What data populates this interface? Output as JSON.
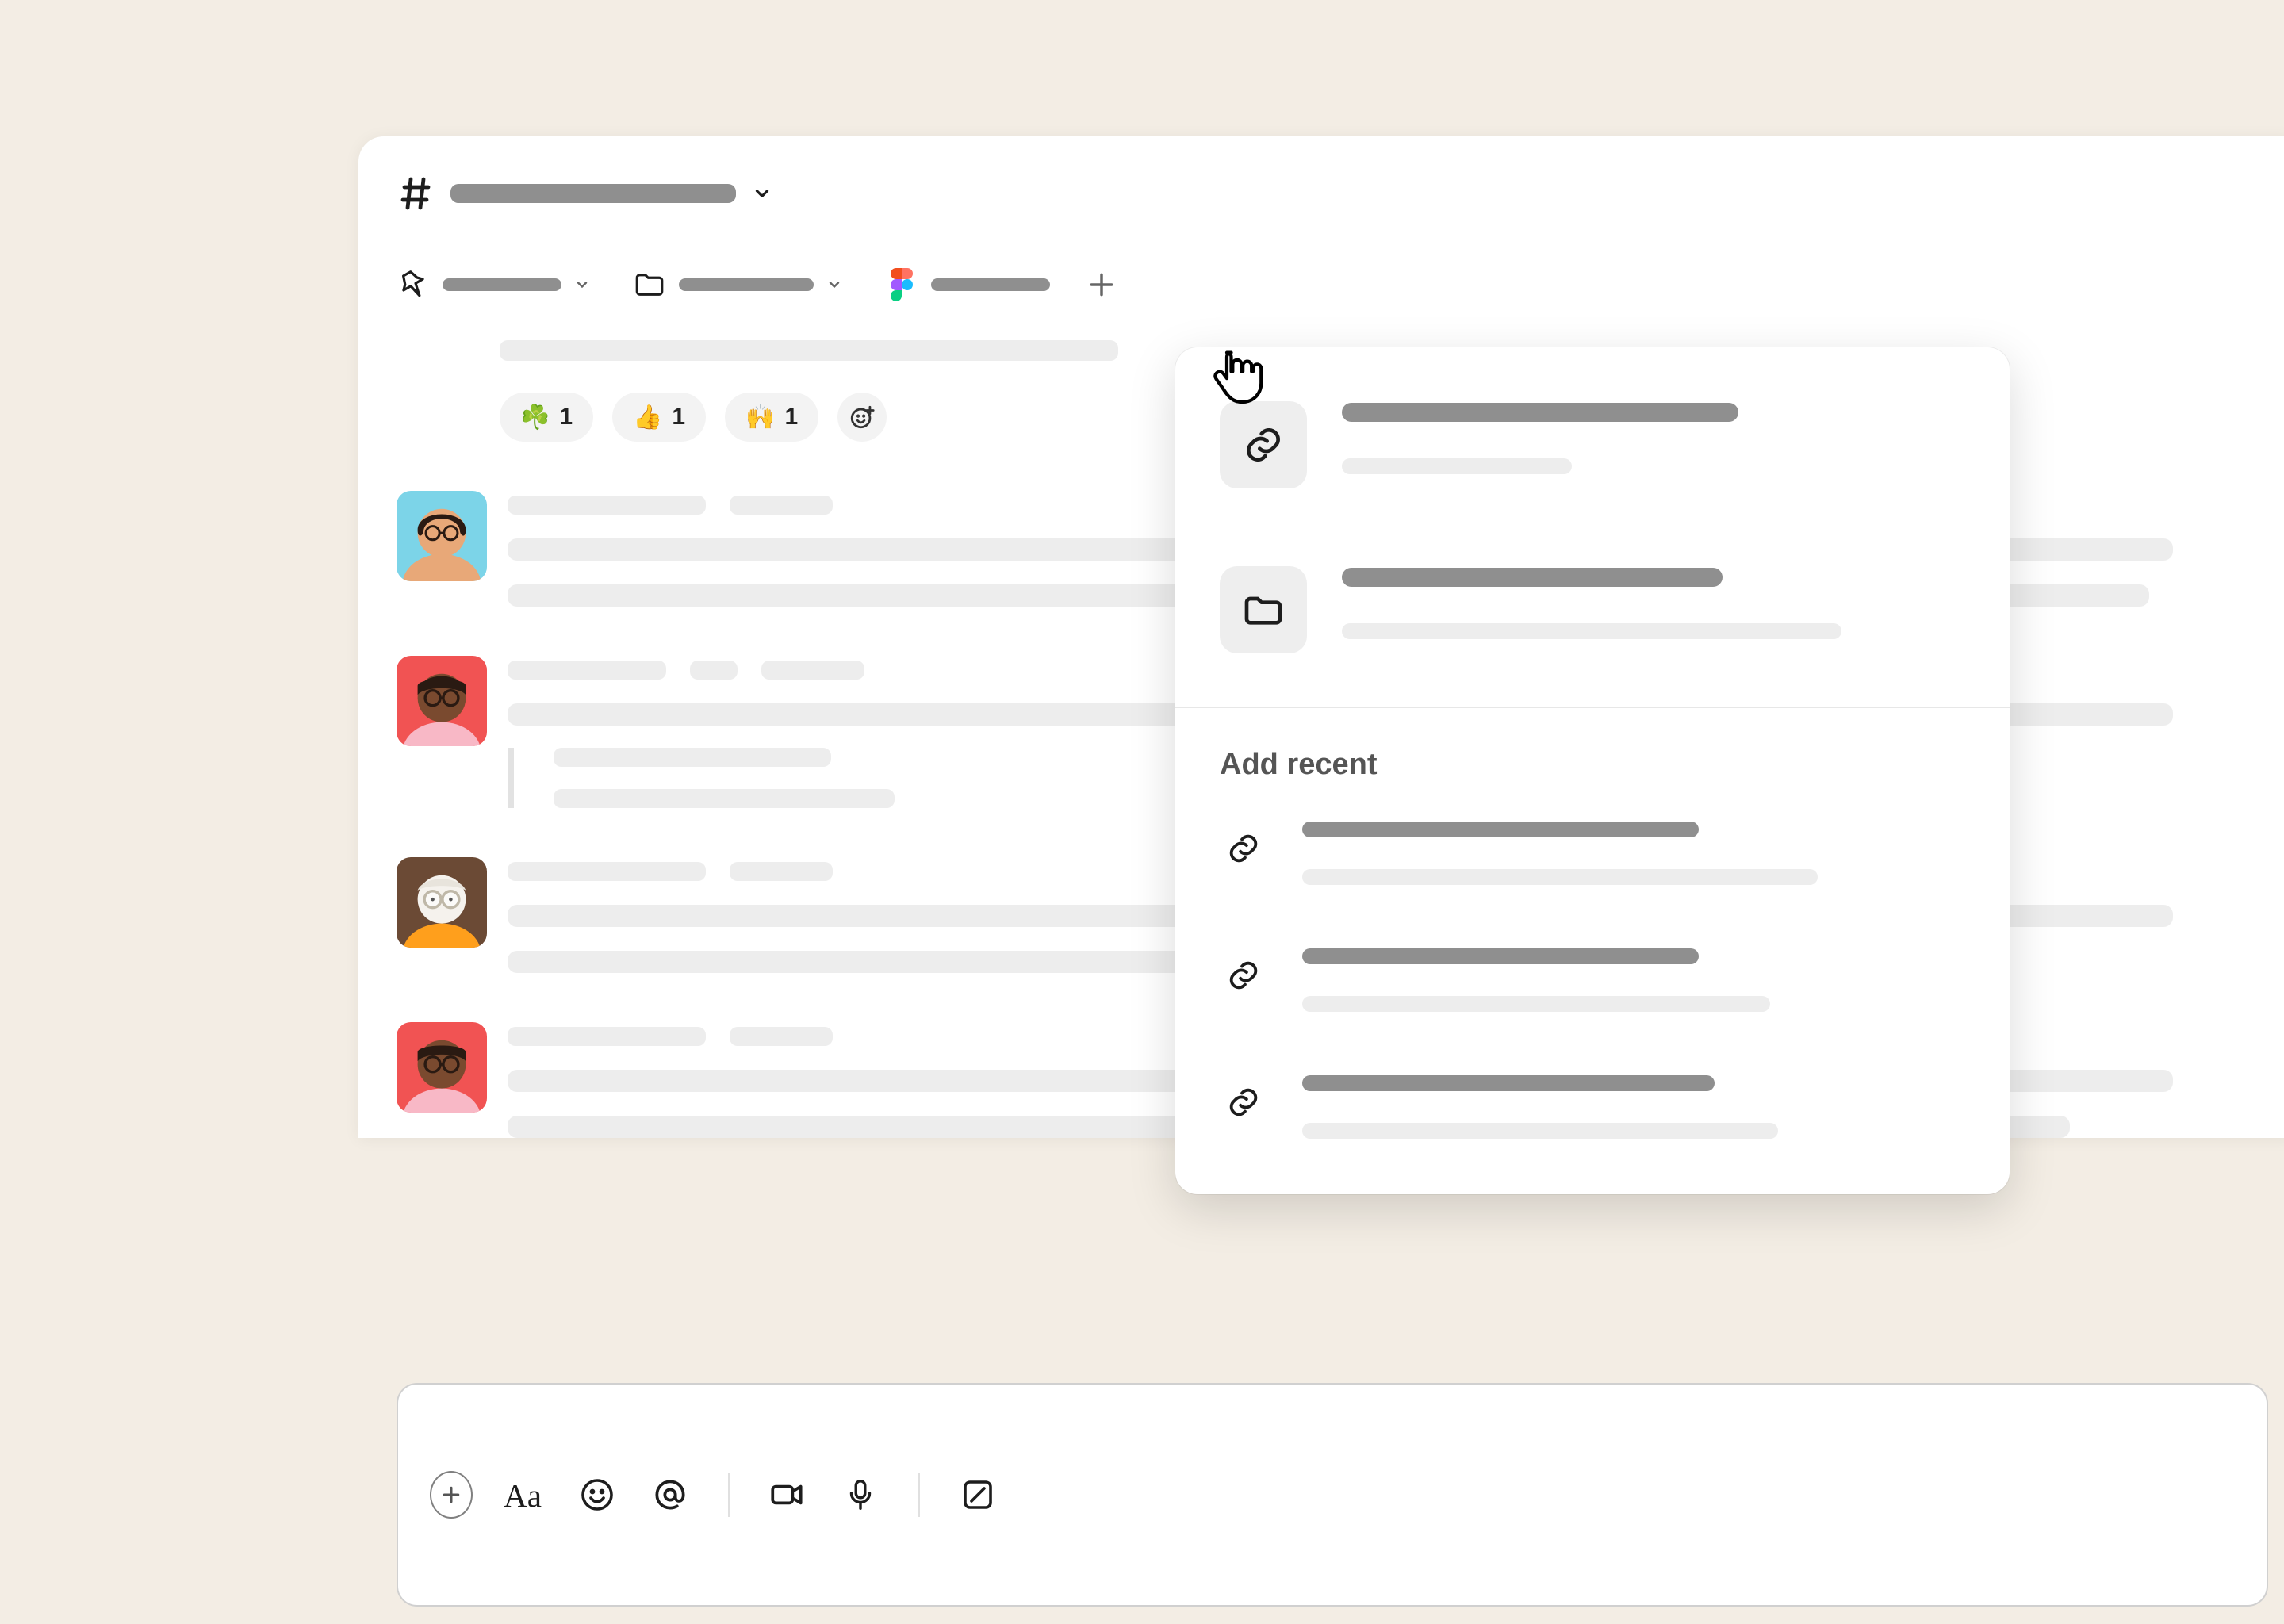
{
  "header": {
    "channel_name_placeholder": "",
    "dropdown_label": ""
  },
  "bookmarks": {
    "items": [
      {
        "icon": "pin",
        "label": ""
      },
      {
        "icon": "folder",
        "label": ""
      },
      {
        "icon": "figma",
        "label": ""
      }
    ],
    "add_label": ""
  },
  "reactions": [
    {
      "emoji": "☘️",
      "count": "1"
    },
    {
      "emoji": "👍",
      "count": "1"
    },
    {
      "emoji": "🙌",
      "count": "1"
    }
  ],
  "messages": [
    {
      "avatar": "person-1",
      "name": "",
      "time": "",
      "lines": [
        ""
      ]
    },
    {
      "avatar": "person-2",
      "name": "",
      "time": "",
      "lines": [
        ""
      ],
      "reply": [
        ""
      ]
    },
    {
      "avatar": "person-3",
      "name": "",
      "time": "",
      "lines": [
        "",
        ""
      ]
    },
    {
      "avatar": "person-2",
      "name": "",
      "time": "",
      "lines": [
        "",
        ""
      ]
    }
  ],
  "popover": {
    "primary": [
      {
        "icon": "link",
        "title": "",
        "subtitle": ""
      },
      {
        "icon": "folder",
        "title": "",
        "subtitle": ""
      }
    ],
    "recent_heading": "Add recent",
    "recent": [
      {
        "icon": "link",
        "title": "",
        "subtitle": ""
      },
      {
        "icon": "link",
        "title": "",
        "subtitle": ""
      },
      {
        "icon": "link",
        "title": "",
        "subtitle": ""
      }
    ]
  },
  "composer": {
    "buttons": [
      "attach",
      "format",
      "emoji",
      "mention",
      "video",
      "audio",
      "canvas"
    ]
  }
}
